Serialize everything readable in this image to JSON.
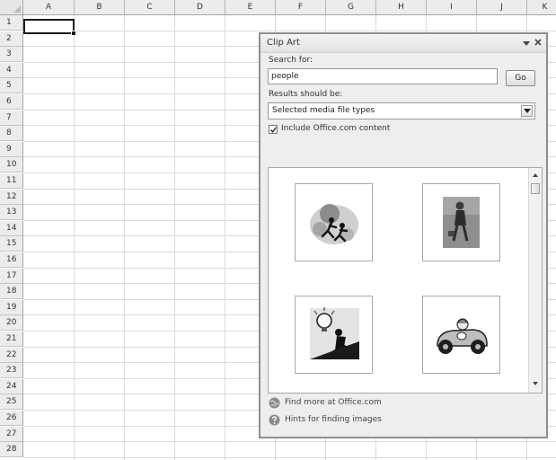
{
  "spreadsheet": {
    "columns": [
      "A",
      "B",
      "C",
      "D",
      "E",
      "F",
      "G",
      "H",
      "I",
      "J",
      "K"
    ],
    "rows": [
      "1",
      "2",
      "3",
      "4",
      "5",
      "6",
      "7",
      "8",
      "9",
      "10",
      "11",
      "12",
      "13",
      "14",
      "15",
      "16",
      "17",
      "18",
      "19",
      "20",
      "21",
      "22",
      "23",
      "24",
      "25",
      "26",
      "27",
      "28"
    ],
    "active_cell": "A1"
  },
  "clip_art_pane": {
    "title": "Clip Art",
    "search_label": "Search for:",
    "search_value": "people",
    "go_label": "Go",
    "results_label": "Results should be:",
    "results_value": "Selected media file types",
    "include_checked": true,
    "include_label": "Include Office.com content",
    "thumbnails": [
      {
        "icon": "running-figures-clipart"
      },
      {
        "icon": "businesswoman-walking-clipart"
      },
      {
        "icon": "lightbulb-climber-clipart"
      },
      {
        "icon": "cartoon-car-driver-clipart"
      }
    ],
    "find_more_link": "Find more at Office.com",
    "hints_link": "Hints for finding images"
  }
}
